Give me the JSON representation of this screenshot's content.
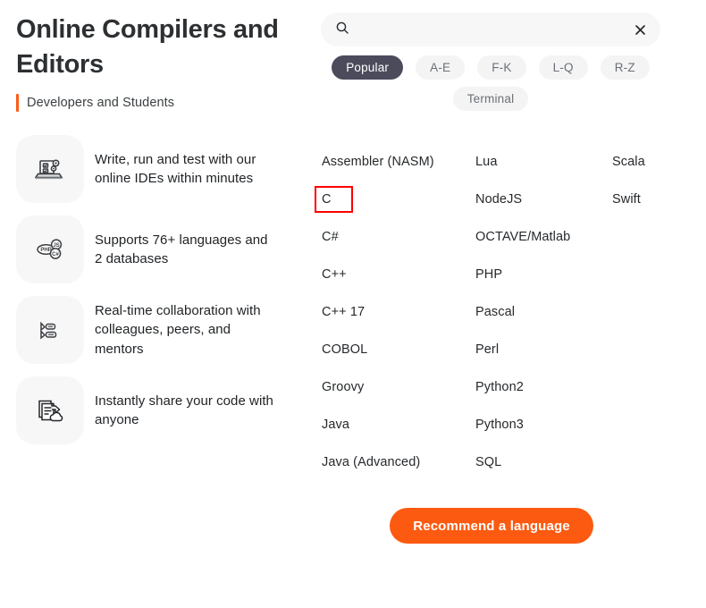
{
  "header": {
    "title": "Online Compilers and Editors",
    "subtitle": "Developers and Students"
  },
  "features": [
    {
      "icon": "laptop-settings-icon",
      "text": "Write, run and test with our online IDEs within minutes"
    },
    {
      "icon": "languages-bubbles-icon",
      "text": "Supports 76+ languages and 2 databases"
    },
    {
      "icon": "collaboration-cursors-icon",
      "text": "Real-time collaboration with colleagues, peers, and mentors"
    },
    {
      "icon": "share-document-cloud-icon",
      "text": "Instantly share your code with anyone"
    }
  ],
  "search": {
    "value": "",
    "placeholder": "",
    "search_icon": "search-icon",
    "clear_icon": "close-icon"
  },
  "filters": {
    "active": "Popular",
    "pills": [
      "Popular",
      "A-E",
      "F-K",
      "L-Q",
      "R-Z",
      "Terminal"
    ]
  },
  "languages": {
    "highlighted": "C",
    "columns": [
      [
        "Assembler (NASM)",
        "C",
        "C#",
        "C++",
        "C++ 17",
        "COBOL",
        "Groovy",
        "Java",
        "Java (Advanced)"
      ],
      [
        "Lua",
        "NodeJS",
        "OCTAVE/Matlab",
        "PHP",
        "Pascal",
        "Perl",
        "Python2",
        "Python3",
        "SQL"
      ],
      [
        "Scala",
        "Swift"
      ]
    ]
  },
  "cta": {
    "label": "Recommend a language"
  },
  "colors": {
    "accent": "#fb5c16",
    "cta": "#fc5a11",
    "active_pill": "#4c4b5c",
    "pill_bg": "#f4f4f5",
    "highlight_box": "#ff0000"
  }
}
